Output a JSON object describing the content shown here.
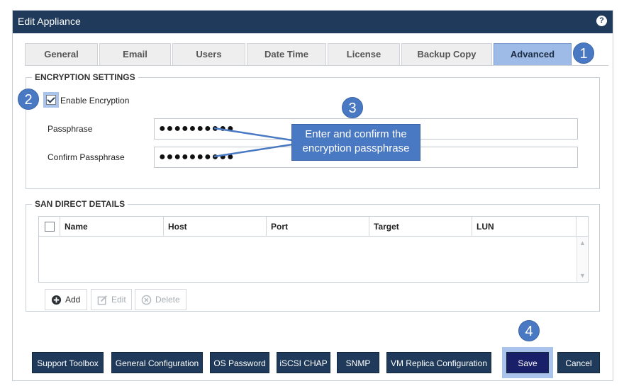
{
  "dialog": {
    "title": "Edit Appliance",
    "help_icon": "?"
  },
  "tabs": [
    {
      "label": "General"
    },
    {
      "label": "Email"
    },
    {
      "label": "Users"
    },
    {
      "label": "Date Time"
    },
    {
      "label": "License"
    },
    {
      "label": "Backup Copy"
    },
    {
      "label": "Advanced",
      "active": true
    }
  ],
  "encryption": {
    "legend": "ENCRYPTION SETTINGS",
    "enable_label": "Enable Encryption",
    "enabled": true,
    "passphrase_label": "Passphrase",
    "passphrase_value": "●●●●●●●●●●",
    "confirm_label": "Confirm Passphrase",
    "confirm_value": "●●●●●●●●●●"
  },
  "san": {
    "legend": "SAN DIRECT DETAILS",
    "columns": [
      "Name",
      "Host",
      "Port",
      "Target",
      "LUN"
    ],
    "rows": [],
    "toolbar": {
      "add": "Add",
      "edit": "Edit",
      "delete": "Delete"
    }
  },
  "footer": {
    "support_toolbox": "Support Toolbox",
    "general_configuration": "General Configuration",
    "os_password": "OS Password",
    "iscsi_chap": "iSCSI CHAP",
    "snmp": "SNMP",
    "vm_replica": "VM Replica Configuration",
    "save": "Save",
    "cancel": "Cancel"
  },
  "annotations": {
    "step1": "1",
    "step2": "2",
    "step3": "3",
    "step4": "4",
    "callout_line1": "Enter and confirm the",
    "callout_line2": "encryption passphrase"
  },
  "colors": {
    "titlebar": "#1f3a5a",
    "accent": "#4a79c4",
    "active_tab": "#9dbbe6"
  }
}
